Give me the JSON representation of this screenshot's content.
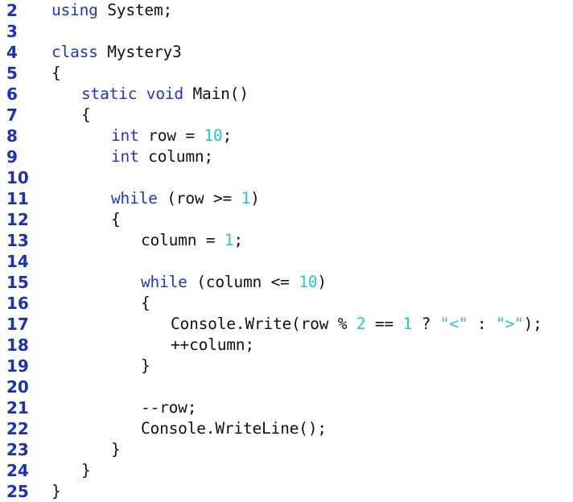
{
  "colors": {
    "line_number": "#1a2fc4",
    "keyword": "#2233dd",
    "literal": "#22c7d8",
    "text": "#111111"
  },
  "lines": [
    {
      "n": "2",
      "indent": 0,
      "tokens": [
        {
          "t": "kw",
          "v": "using"
        },
        {
          "t": "txt",
          "v": " System;"
        }
      ]
    },
    {
      "n": "3",
      "indent": 0,
      "tokens": []
    },
    {
      "n": "4",
      "indent": 0,
      "tokens": [
        {
          "t": "kw",
          "v": "class"
        },
        {
          "t": "txt",
          "v": " Mystery3"
        }
      ]
    },
    {
      "n": "5",
      "indent": 0,
      "tokens": [
        {
          "t": "txt",
          "v": "{"
        }
      ]
    },
    {
      "n": "6",
      "indent": 1,
      "tokens": [
        {
          "t": "kw",
          "v": "static"
        },
        {
          "t": "txt",
          "v": " "
        },
        {
          "t": "kw",
          "v": "void"
        },
        {
          "t": "txt",
          "v": " Main()"
        }
      ]
    },
    {
      "n": "7",
      "indent": 1,
      "tokens": [
        {
          "t": "txt",
          "v": "{"
        }
      ]
    },
    {
      "n": "8",
      "indent": 2,
      "tokens": [
        {
          "t": "kw",
          "v": "int"
        },
        {
          "t": "txt",
          "v": " row = "
        },
        {
          "t": "num",
          "v": "10"
        },
        {
          "t": "txt",
          "v": ";"
        }
      ]
    },
    {
      "n": "9",
      "indent": 2,
      "tokens": [
        {
          "t": "kw",
          "v": "int"
        },
        {
          "t": "txt",
          "v": " column;"
        }
      ]
    },
    {
      "n": "10",
      "indent": 0,
      "tokens": []
    },
    {
      "n": "11",
      "indent": 2,
      "tokens": [
        {
          "t": "kw",
          "v": "while"
        },
        {
          "t": "txt",
          "v": " (row >= "
        },
        {
          "t": "num",
          "v": "1"
        },
        {
          "t": "txt",
          "v": ")"
        }
      ]
    },
    {
      "n": "12",
      "indent": 2,
      "tokens": [
        {
          "t": "txt",
          "v": "{"
        }
      ]
    },
    {
      "n": "13",
      "indent": 3,
      "tokens": [
        {
          "t": "txt",
          "v": "column = "
        },
        {
          "t": "num",
          "v": "1"
        },
        {
          "t": "txt",
          "v": ";"
        }
      ]
    },
    {
      "n": "14",
      "indent": 0,
      "tokens": []
    },
    {
      "n": "15",
      "indent": 3,
      "tokens": [
        {
          "t": "kw",
          "v": "while"
        },
        {
          "t": "txt",
          "v": " (column <= "
        },
        {
          "t": "num",
          "v": "10"
        },
        {
          "t": "txt",
          "v": ")"
        }
      ]
    },
    {
      "n": "16",
      "indent": 3,
      "tokens": [
        {
          "t": "txt",
          "v": "{"
        }
      ]
    },
    {
      "n": "17",
      "indent": 4,
      "tokens": [
        {
          "t": "txt",
          "v": "Console.Write(row % "
        },
        {
          "t": "num",
          "v": "2"
        },
        {
          "t": "txt",
          "v": " == "
        },
        {
          "t": "num",
          "v": "1"
        },
        {
          "t": "txt",
          "v": " ? "
        },
        {
          "t": "str",
          "v": "\"<\""
        },
        {
          "t": "txt",
          "v": " : "
        },
        {
          "t": "str",
          "v": "\">\""
        },
        {
          "t": "txt",
          "v": ");"
        }
      ]
    },
    {
      "n": "18",
      "indent": 4,
      "tokens": [
        {
          "t": "txt",
          "v": "++column;"
        }
      ]
    },
    {
      "n": "19",
      "indent": 3,
      "tokens": [
        {
          "t": "txt",
          "v": "}"
        }
      ]
    },
    {
      "n": "20",
      "indent": 0,
      "tokens": []
    },
    {
      "n": "21",
      "indent": 3,
      "tokens": [
        {
          "t": "txt",
          "v": "--row;"
        }
      ]
    },
    {
      "n": "22",
      "indent": 3,
      "tokens": [
        {
          "t": "txt",
          "v": "Console.WriteLine();"
        }
      ]
    },
    {
      "n": "23",
      "indent": 2,
      "tokens": [
        {
          "t": "txt",
          "v": "}"
        }
      ]
    },
    {
      "n": "24",
      "indent": 1,
      "tokens": [
        {
          "t": "txt",
          "v": "}"
        }
      ]
    },
    {
      "n": "25",
      "indent": 0,
      "tokens": [
        {
          "t": "txt",
          "v": "}"
        }
      ]
    }
  ]
}
